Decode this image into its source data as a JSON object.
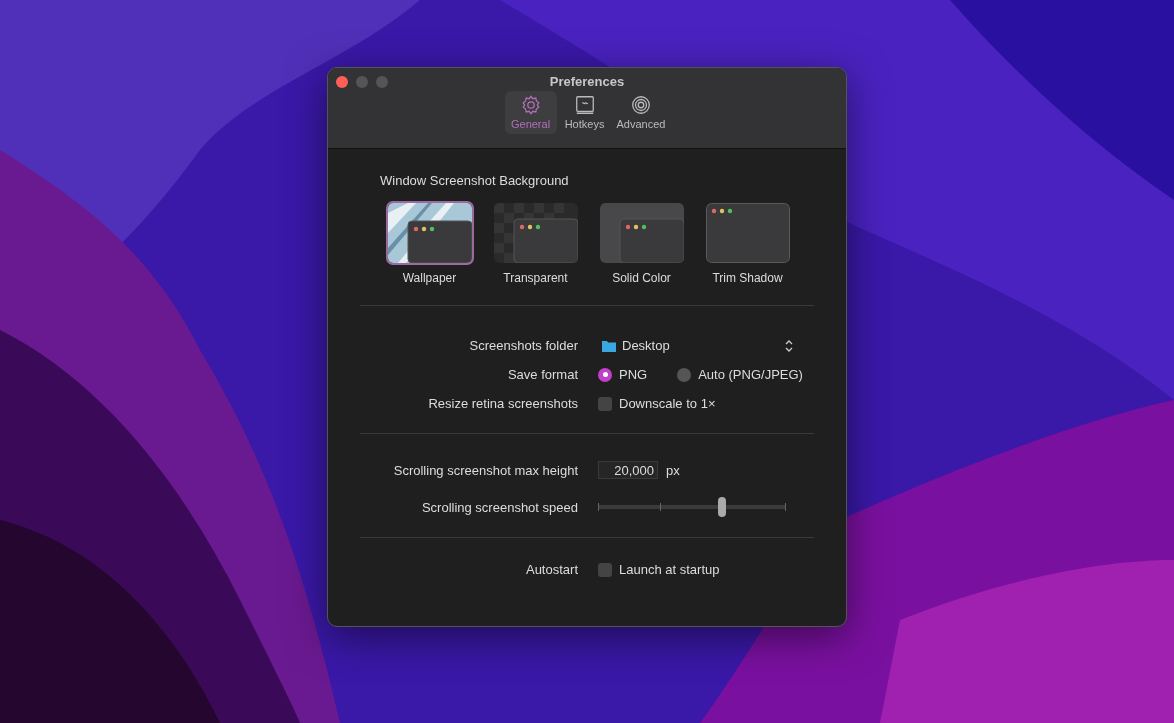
{
  "window": {
    "title": "Preferences"
  },
  "tabs": [
    {
      "label": "General",
      "selected": true,
      "kind": "gear"
    },
    {
      "label": "Hotkeys",
      "selected": false,
      "kind": "keyboard"
    },
    {
      "label": "Advanced",
      "selected": false,
      "kind": "spiral"
    }
  ],
  "background_section": {
    "title": "Window Screenshot Background",
    "options": [
      {
        "label": "Wallpaper",
        "selected": true,
        "kind": "wallpaper"
      },
      {
        "label": "Transparent",
        "selected": false,
        "kind": "transparent"
      },
      {
        "label": "Solid Color",
        "selected": false,
        "kind": "solid"
      },
      {
        "label": "Trim Shadow",
        "selected": false,
        "kind": "trim"
      }
    ]
  },
  "groups": [
    [
      {
        "kind": "popup",
        "label": "Screenshots folder",
        "value": "Desktop"
      },
      {
        "kind": "radio",
        "label": "Save format",
        "options": [
          {
            "label": "PNG",
            "selected": true
          },
          {
            "label": "Auto (PNG/JPEG)",
            "selected": false
          }
        ]
      },
      {
        "kind": "checkbox",
        "label": "Resize retina screenshots",
        "text": "Downscale to 1×",
        "checked": false
      }
    ],
    [
      {
        "kind": "number",
        "label": "Scrolling screenshot max height",
        "value": "20,000",
        "unit": "px"
      },
      {
        "kind": "slider",
        "label": "Scrolling screenshot speed",
        "level": 0.66
      }
    ],
    [
      {
        "kind": "checkbox",
        "label": "Autostart",
        "text": "Launch at startup",
        "checked": false
      }
    ]
  ]
}
